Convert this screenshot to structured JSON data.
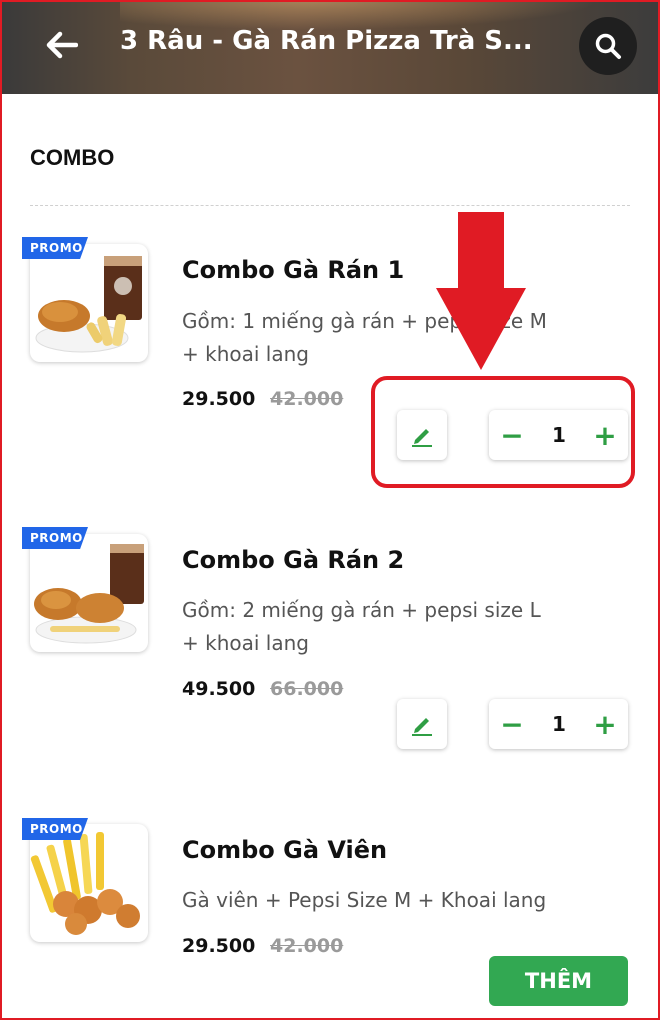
{
  "header": {
    "title": "3 Râu - Gà Rán Pizza Trà S...",
    "back_icon": "arrow-left-icon",
    "search_icon": "search-icon"
  },
  "section": {
    "title": "COMBO"
  },
  "items": [
    {
      "badge": "PROMO",
      "name": "Combo Gà Rán 1",
      "desc_line1": "Gồm: 1 miếng gà rán + pepsi size M",
      "desc_line2": "+ khoai lang",
      "price": "29.500",
      "old_price": "42.000",
      "quantity": "1"
    },
    {
      "badge": "PROMO",
      "name": "Combo Gà Rán 2",
      "desc_line1": "Gồm: 2 miếng gà rán + pepsi size L",
      "desc_line2": "+ khoai lang",
      "price": "49.500",
      "old_price": "66.000",
      "quantity": "1"
    },
    {
      "badge": "PROMO",
      "name": "Combo Gà Viên",
      "desc_line1": "Gà viên + Pepsi Size M + Khoai lang",
      "price": "29.500",
      "old_price": "42.000",
      "add_label": "THÊM"
    }
  ],
  "stepper": {
    "minus": "−",
    "plus": "+"
  },
  "colors": {
    "accent_green": "#32a852",
    "promo_blue": "#2166e8",
    "annotation_red": "#e01b24"
  }
}
